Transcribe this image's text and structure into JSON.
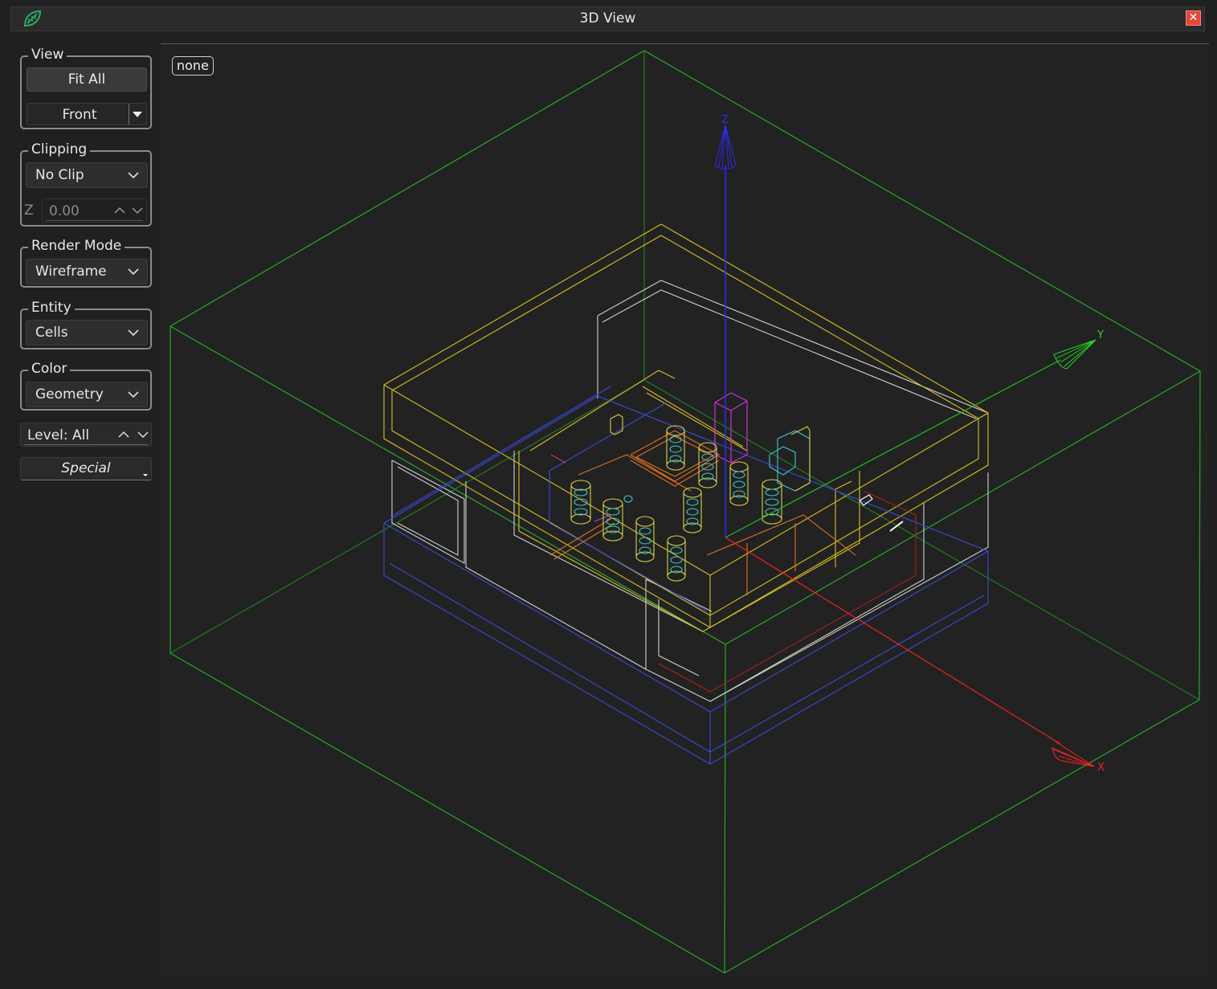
{
  "window": {
    "title": "3D View",
    "close_symbol": "✕"
  },
  "panel": {
    "view": {
      "label": "View",
      "fit_all": "Fit All",
      "orientation": "Front"
    },
    "clipping": {
      "label": "Clipping",
      "mode": "No Clip",
      "axis": "Z",
      "value": "0.00"
    },
    "render_mode": {
      "label": "Render Mode",
      "value": "Wireframe"
    },
    "entity": {
      "label": "Entity",
      "value": "Cells"
    },
    "color": {
      "label": "Color",
      "value": "Geometry"
    },
    "level": {
      "value": "Level: All"
    },
    "special": {
      "label": "Special"
    }
  },
  "viewport": {
    "selection_badge": "none",
    "axes": {
      "x": "X",
      "y": "Y",
      "z": "Z"
    },
    "colors": {
      "x_axis": "#ff2020",
      "y_axis": "#22dd22",
      "z_axis": "#2222ff",
      "bounding_box": "#2aa52a"
    }
  }
}
